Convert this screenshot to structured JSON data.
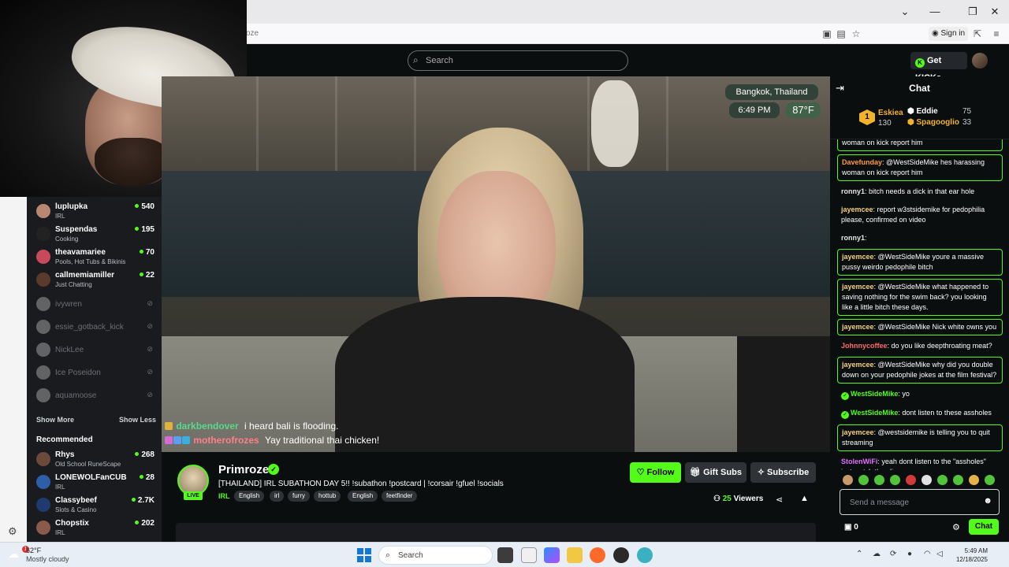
{
  "browser": {
    "url_fragment": "oze",
    "sign_in": "Sign in"
  },
  "header": {
    "search_placeholder": "Search",
    "get_kicks": "Get KICKs"
  },
  "sidebar": {
    "following": [
      {
        "name": "luplupka",
        "category": "IRL",
        "viewers": "540",
        "avatar_color": "#b98771"
      },
      {
        "name": "Suspendas",
        "category": "Cooking",
        "viewers": "195",
        "avatar_color": "#222222"
      },
      {
        "name": "theavamariee",
        "category": "Pools, Hot Tubs & Bikinis",
        "viewers": "70",
        "avatar_color": "#c74a5a"
      },
      {
        "name": "callmemiamiller",
        "category": "Just Chatting",
        "viewers": "22",
        "avatar_color": "#5a3a2a"
      }
    ],
    "offline": [
      {
        "name": "ivywren"
      },
      {
        "name": "essie_gotback_kick"
      },
      {
        "name": "NickLee"
      },
      {
        "name": "Ice Poseidon"
      },
      {
        "name": "aquamoose"
      }
    ],
    "show_more": "Show More",
    "show_less": "Show Less",
    "recommended_title": "Recommended",
    "recommended": [
      {
        "name": "Rhys",
        "category": "Old School RuneScape",
        "viewers": "268",
        "avatar_color": "#6b4a3a"
      },
      {
        "name": "LONEWOLFanCUB",
        "category": "IRL",
        "viewers": "28",
        "avatar_color": "#2c5fa8"
      },
      {
        "name": "Classybeef",
        "category": "Slots & Casino",
        "viewers": "2.7K",
        "avatar_color": "#1e3a6e"
      },
      {
        "name": "Chopstix",
        "category": "IRL",
        "viewers": "202",
        "avatar_color": "#8a5a4a"
      }
    ]
  },
  "video": {
    "location": "Bangkok, Thailand",
    "time": "6:49 PM",
    "temp": "87°F",
    "overlay_chat": [
      {
        "user": "darkbendover",
        "message": "i heard bali is flooding."
      },
      {
        "user": "motherofrozes",
        "message": "Yay traditional thai chicken!"
      }
    ]
  },
  "stream": {
    "name": "Primroze",
    "live": "LIVE",
    "title": "[THAILAND] IRL SUBATHON DAY 5!! !subathon !postcard | !corsair !gfuel !socials",
    "category": "IRL",
    "tags": [
      "English",
      "irl",
      "furry",
      "hottub",
      "English",
      "feetfinder"
    ],
    "follow": "Follow",
    "gift_subs": "Gift Subs",
    "subscribe": "Subscribe",
    "viewers": "25",
    "viewers_label": "Viewers"
  },
  "chat": {
    "title": "Chat",
    "leaderboard": {
      "rank": "1",
      "first": {
        "name": "Eskiea",
        "value": "130"
      },
      "second": {
        "name": "Eddie",
        "value": "75"
      },
      "third": {
        "name": "Spagooglio",
        "value": "33"
      }
    },
    "messages": [
      {
        "user": "",
        "text": "woman on kick report him",
        "highlight": true,
        "color": "u-orange"
      },
      {
        "user": "Davefunday",
        "text": ": @WestSideMike hes harassing woman on kick report him",
        "highlight": true,
        "color": "u-orange"
      },
      {
        "user": "ronny1",
        "text": ": bitch needs a dick in that ear hole",
        "highlight": false,
        "color": "u-gray"
      },
      {
        "user": "jayemcee",
        "text": ": report w3stsidemike for pedophilia please, confirmed on video",
        "highlight": false,
        "color": "u-yellow"
      },
      {
        "user": "ronny1",
        "text": ":",
        "highlight": false,
        "color": "u-gray"
      },
      {
        "user": "jayemcee",
        "text": ": @WestSideMike youre a massive pussy weirdo pedophile bitch",
        "highlight": true,
        "color": "u-yellow"
      },
      {
        "user": "jayemcee",
        "text": ": @WestSideMike what happened to saving nothing for the swim back? you looking like a little bitch these days.",
        "highlight": true,
        "color": "u-yellow"
      },
      {
        "user": "jayemcee",
        "text": ": @WestSideMike Nick white owns you",
        "highlight": true,
        "color": "u-yellow"
      },
      {
        "user": "Johnnycoffee",
        "text": ": do you like deepthroating meat?",
        "highlight": false,
        "color": "u-red"
      },
      {
        "user": "jayemcee",
        "text": ": @WestSideMike why did you double down on your pedophile jokes at the film festival?",
        "highlight": true,
        "color": "u-yellow"
      },
      {
        "user": "WestSideMike",
        "text": ": yo",
        "highlight": false,
        "color": "u-green",
        "badge": true
      },
      {
        "user": "WestSideMike",
        "text": ": dont listen to these assholes",
        "highlight": false,
        "color": "u-green",
        "badge": true
      },
      {
        "user": "jayemcee",
        "text": ": @westsidemike is telling you to quit streaming",
        "highlight": true,
        "color": "u-yellow"
      },
      {
        "user": "StolenWiFi",
        "text": ": yeah dont listen to the \"assholes\" just watch the clips",
        "highlight": false,
        "color": "u-pink"
      }
    ],
    "input_placeholder": "Send a message",
    "points": "0",
    "send": "Chat"
  },
  "taskbar": {
    "temp": "62°F",
    "condition": "Mostly cloudy",
    "badge": "1",
    "search": "Search",
    "time": "5:49 AM",
    "date": "12/18/2025"
  }
}
